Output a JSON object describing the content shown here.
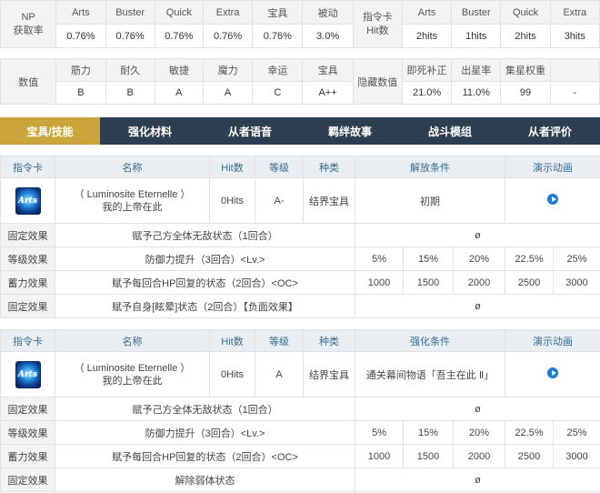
{
  "np_table": {
    "np_label": "NP\n获取率",
    "np_headers": [
      "Arts",
      "Buster",
      "Quick",
      "Extra",
      "宝具",
      "被动"
    ],
    "np_values": [
      "0.76%",
      "0.76%",
      "0.76%",
      "0.76%",
      "0.76%",
      "3.0%"
    ],
    "hit_label": "指令卡\nHit数",
    "hit_headers": [
      "Arts",
      "Buster",
      "Quick",
      "Extra"
    ],
    "hit_values": [
      "2hits",
      "1hits",
      "2hits",
      "3hits"
    ]
  },
  "stat_table": {
    "stat_label": "数值",
    "stat_headers": [
      "筋力",
      "耐久",
      "敏捷",
      "魔力",
      "幸运",
      "宝具"
    ],
    "stat_values": [
      "B",
      "B",
      "A",
      "A",
      "C",
      "A++"
    ],
    "hidden_label": "隐藏数值",
    "hidden_headers": [
      "即死补正",
      "出星率",
      "集星权重",
      ""
    ],
    "hidden_values": [
      "21.0%",
      "11.0%",
      "99",
      "-"
    ]
  },
  "tabs": [
    "宝具/技能",
    "强化材料",
    "从者语音",
    "羁绊故事",
    "战斗模组",
    "从者评价"
  ],
  "np_blocks": [
    {
      "headers": [
        "指令卡",
        "名称",
        "Hit数",
        "等级",
        "种类",
        "解放条件",
        "演示动画"
      ],
      "card": "Arts",
      "name_line1": "（ Luminosite Eternelle ）",
      "name_line2": "我的上帝在此",
      "hits": "0Hits",
      "rank": "A-",
      "type": "结界宝具",
      "condition": "初期",
      "effects": [
        {
          "label": "固定效果",
          "desc": "赋予己方全体无敌状态（1回合）",
          "values": [
            "ø"
          ]
        },
        {
          "label": "等级效果",
          "desc": "防御力提升（3回合）<Lv.>",
          "values": [
            "5%",
            "15%",
            "20%",
            "22.5%",
            "25%"
          ]
        },
        {
          "label": "蓄力效果",
          "desc": "赋予每回合HP回复的状态（2回合）<OC>",
          "values": [
            "1000",
            "1500",
            "2000",
            "2500",
            "3000"
          ]
        },
        {
          "label": "固定效果",
          "desc": "赋予自身[眩晕]状态（2回合）【负面效果】",
          "values": [
            "ø"
          ]
        }
      ]
    },
    {
      "headers": [
        "指令卡",
        "名称",
        "Hit数",
        "等级",
        "种类",
        "强化条件",
        "演示动画"
      ],
      "card": "Arts",
      "name_line1": "（ Luminosite Eternelle ）",
      "name_line2": "我的上帝在此",
      "hits": "0Hits",
      "rank": "A",
      "type": "结界宝具",
      "condition": "通关幕间物语「吾主在此 Ⅱ」",
      "effects": [
        {
          "label": "固定效果",
          "desc": "赋予己方全体无敌状态（1回合）",
          "values": [
            "ø"
          ]
        },
        {
          "label": "等级效果",
          "desc": "防御力提升（3回合）<Lv.>",
          "values": [
            "5%",
            "15%",
            "20%",
            "22.5%",
            "25%"
          ]
        },
        {
          "label": "蓄力效果",
          "desc": "赋予每回合HP回复的状态（2回合）<OC>",
          "values": [
            "1000",
            "1500",
            "2000",
            "2500",
            "3000"
          ]
        },
        {
          "label": "固定效果",
          "desc": "解除弱体状态",
          "values": [
            "ø"
          ]
        }
      ]
    }
  ],
  "colors": {
    "tab_bg": "#2c3e50",
    "tab_active": "#c9a53b",
    "header_text": "#3a6a8c",
    "play_icon": "#1e7bd6"
  }
}
